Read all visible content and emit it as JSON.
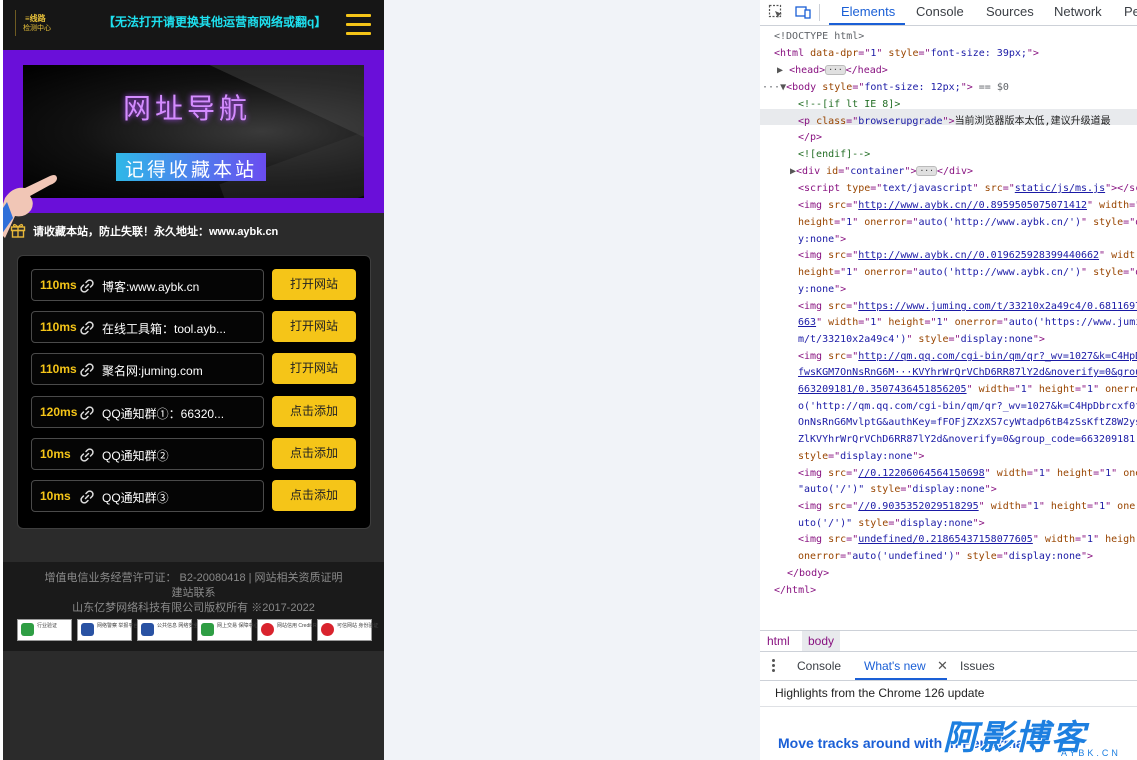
{
  "site": {
    "logo_line1": "≡线路",
    "logo_line2": "检测中心",
    "notice": "【无法打开请更换其他运营商网络或翻q】",
    "banner_title": "网址导航",
    "banner_slogan": "记得收藏本站",
    "tip": "请收藏本站，防止失联！永久地址：www.aybk.cn",
    "links": [
      {
        "ms": "110ms",
        "name": "博客:www.aybk.cn",
        "button": "打开网站"
      },
      {
        "ms": "110ms",
        "name": "在线工具箱：tool.ayb...",
        "button": "打开网站"
      },
      {
        "ms": "110ms",
        "name": "聚名网:juming.com",
        "button": "打开网站"
      },
      {
        "ms": "120ms",
        "name": "QQ通知群①：66320...",
        "button": "点击添加"
      },
      {
        "ms": "10ms",
        "name": "QQ通知群②",
        "button": "点击添加"
      },
      {
        "ms": "10ms",
        "name": "QQ通知群③",
        "button": "点击添加"
      }
    ],
    "footer": {
      "license": "增值电信业务经营许可证： B2-20080418 | 网站相关资质证明",
      "contact": "建站联系",
      "copyright": "山东亿梦网络科技有限公司版权所有 ※2017-2022",
      "badges": [
        {
          "label": "行业验证",
          "icon_color": "#2f9e44"
        },
        {
          "label": "网络警察 举报平台",
          "icon_color": "#2952a3"
        },
        {
          "label": "公共信息 网络安全监察",
          "icon_color": "#2952a3"
        },
        {
          "label": "网上交易 保障中心",
          "icon_color": "#2f9e44"
        },
        {
          "label": "网站信用 Credit Rating",
          "icon_color": "#d9232d"
        },
        {
          "label": "可信网站 身份验证",
          "icon_color": "#d9232d"
        }
      ]
    },
    "colors": {
      "accent": "#f5c518",
      "notice": "#1ee0ef",
      "banner_bg": "#6a0fd9"
    }
  },
  "devtools": {
    "tabs": [
      "Elements",
      "Console",
      "Sources",
      "Network",
      "Pe"
    ],
    "active_tab": "Elements",
    "code": {
      "l1": "<!DOCTYPE html>",
      "l2a": "<html ",
      "l2b": "data-dpr",
      "l2c": "=\"",
      "l2d": "1",
      "l2e": "\" ",
      "l2f": "style",
      "l2g": "=\"",
      "l2h": "font-size: 39px;",
      "l2i": "\">",
      "l3a": "<head>",
      "l3b": "</head>",
      "l4a": "<body ",
      "l4b": "style",
      "l4c": "=\"",
      "l4d": "font-size: 12px;",
      "l4e": "\">",
      "l4f": " == $0",
      "l5": "<!--[if lt IE 8]>",
      "l6a": "<p ",
      "l6b": "class",
      "l6c": "=\"",
      "l6d": "browserupgrade",
      "l6e": "\">",
      "l6f": "当前浏览器版本太低,建议升级道最",
      "l7": "</p>",
      "l8": "<![endif]-->",
      "l9a": "<div ",
      "l9b": "id",
      "l9c": "=\"",
      "l9d": "container",
      "l9e": "\">",
      "l9f": "</div>",
      "l10a": "<script ",
      "l10b": "type",
      "l10c": "=\"",
      "l10d": "text/javascript",
      "l10e": "\" ",
      "l10f": "src",
      "l10g": "=\"",
      "l10h": "static/js/ms.js",
      "l10i": "\"></sc",
      "i1a": "<img ",
      "i1b": "src",
      "i1c": "=\"",
      "i1d": "http://www.aybk.cn//0.8959505075071412",
      "i1e": "\" ",
      "i1f": "width",
      "i1g": "=\"",
      "i1h": "height",
      "i1i": "=\"",
      "i1j": "1",
      "i1k": "\" ",
      "i1l": "onerror",
      "i1m": "=\"",
      "i1n": "auto('http://www.aybk.cn/')",
      "i1o": "\" ",
      "i1p": "style",
      "i1q": "=\"d",
      "i1r": "y:none",
      "i1s": "\">",
      "i2a": "<img ",
      "i2b": "src",
      "i2c": "=\"",
      "i2d": "http://www.aybk.cn//0.019625928399440662",
      "i2e": "\" ",
      "i2f": "widt",
      "i2h": "height",
      "i2i": "=\"",
      "i2j": "1",
      "i2k": "\" ",
      "i2l": "onerror",
      "i2m": "=\"",
      "i2n": "auto('http://www.aybk.cn/')",
      "i2o": "\" ",
      "i2p": "style",
      "i2q": "=\"d",
      "i2r": "y:none",
      "i2s": "\">",
      "i3a": "<img ",
      "i3b": "src",
      "i3c": "=\"",
      "i3d": "https://www.juming.com/t/33210x2a49c4/0.6811697",
      "i3e": "663",
      "i3f": "\" ",
      "i3g": "width",
      "i3h": "=\"",
      "i3i": "1",
      "i3j": "\" ",
      "i3k": "height",
      "i3l": "=\"",
      "i3m": "1",
      "i3n": "\" ",
      "i3o": "onerror",
      "i3p": "=\"",
      "i3q": "auto('https://www.jumi",
      "i3r": "m/t/33210x2a49c4')",
      "i3s": "\" ",
      "i3t": "style",
      "i3u": "=\"",
      "i3v": "display:none",
      "i3w": "\">",
      "i4a": "<img ",
      "i4b": "src",
      "i4c": "=\"",
      "i4d": "http://qm.qq.com/cgi-bin/qm/qr?_wv=1027&k=C4HpD",
      "i4e": "fwsKGM7OnNsRnG6M···KVYhrWrQrVChD6RR87lY2d&noverify=0&group",
      "i4f": "663209181/0.3507436451856205",
      "i4g": "\" ",
      "i4h": "width",
      "i4i": "=\"",
      "i4j": "1",
      "i4k": "\" ",
      "i4l": "height",
      "i4m": "=\"",
      "i4n": "1",
      "i4o": "\" ",
      "i4p": "onerro",
      "i4q": "o('http://qm.qq.com/cgi-bin/qm/qr?_wv=1027&k=C4HpDbrcxf0f",
      "i4r": "OnNsRnG6MvlptG&authKey=fFOFjZXzXS7cyWtadp6tB4zSsKftZ8W2ys",
      "i4s": "ZlKVYhrWrQrVChD6RR87lY2d&noverify=0&group_code=663209181'",
      "i4t": "style",
      "i4u": "=\"",
      "i4v": "display:none",
      "i4w": "\">",
      "i5a": "<img ",
      "i5b": "src",
      "i5c": "=\"",
      "i5d": "//0.12206064564150698",
      "i5e": "\" ",
      "i5f": "width",
      "i5g": "=\"",
      "i5h": "1",
      "i5i": "\" ",
      "i5j": "height",
      "i5k": "=\"",
      "i5l": "1",
      "i5m": "\" ",
      "i5n": "one",
      "i5o": "\"auto('/')\"",
      "i5p": " ",
      "i5q": "style",
      "i5r": "=\"",
      "i5s": "display:none",
      "i5t": "\">",
      "i6a": "<img ",
      "i6b": "src",
      "i6c": "=\"",
      "i6d": "//0.9035352029518295",
      "i6e": "\" ",
      "i6f": "width",
      "i6g": "=\"",
      "i6h": "1",
      "i6i": "\" ",
      "i6j": "height",
      "i6k": "=\"",
      "i6l": "1",
      "i6m": "\" ",
      "i6n": "oner",
      "i6o": "uto('/')\"",
      "i6p": " ",
      "i6q": "style",
      "i6r": "=\"",
      "i6s": "display:none",
      "i6t": "\">",
      "i7a": "<img ",
      "i7b": "src",
      "i7c": "=\"",
      "i7d": "undefined/0.21865437158077605",
      "i7e": "\" ",
      "i7f": "width",
      "i7g": "=\"",
      "i7h": "1",
      "i7i": "\" ",
      "i7j": "heigh",
      "i7k": "onerror",
      "i7l": "=\"",
      "i7m": "auto('undefined')",
      "i7n": "\" ",
      "i7o": "style",
      "i7p": "=\"",
      "i7q": "display:none",
      "i7r": "\">",
      "end1": "</body>",
      "end2": "</html>"
    },
    "breadcrumbs": [
      "html",
      "body"
    ],
    "drawer_tabs": [
      "Console",
      "What's new",
      "Issues"
    ],
    "highlight": "Highlights from the Chrome 126 update",
    "move_tracks": "Move tracks around with",
    "move_tracks_tail": "in Performa",
    "watermark": "阿影博客",
    "watermark_sub": "AYBK.CN"
  }
}
